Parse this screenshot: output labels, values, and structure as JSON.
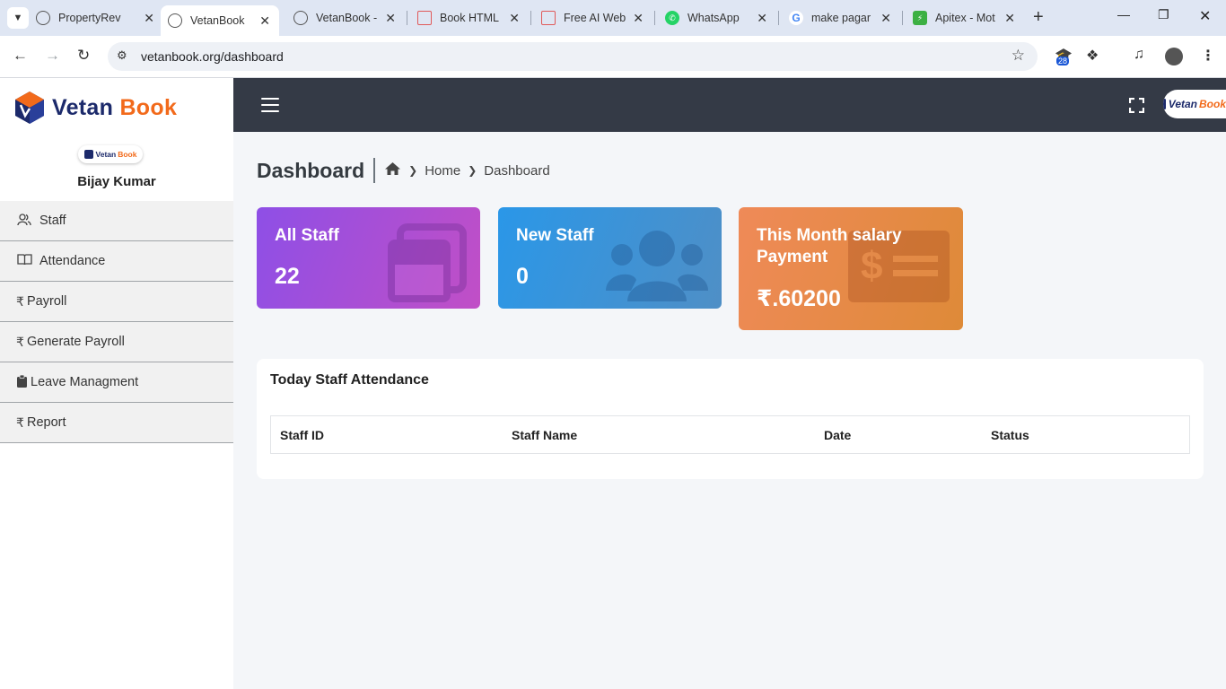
{
  "browser": {
    "tabs": [
      {
        "title": "PropertyReview",
        "icon": "globe-icon"
      },
      {
        "title": "VetanBook",
        "icon": "globe-icon",
        "active": true
      },
      {
        "title": "VetanBook - ",
        "icon": "globe-icon"
      },
      {
        "title": "Book HTML",
        "icon": "document-icon"
      },
      {
        "title": "Free AI Web",
        "icon": "document-icon"
      },
      {
        "title": "WhatsApp",
        "icon": "whatsapp-icon"
      },
      {
        "title": "make pagar",
        "icon": "google-icon"
      },
      {
        "title": "Apitex - Mot",
        "icon": "bolt-icon"
      }
    ],
    "url": "vetanbook.org/dashboard",
    "extensions_badge": "28"
  },
  "brand": {
    "name_part1": "Vetan",
    "name_part2": "Book",
    "mini_part1": "Vetan",
    "mini_part2": "Book",
    "colors": {
      "primary": "#1c2a6b",
      "accent": "#f26a1b"
    }
  },
  "user": {
    "name": "Bijay Kumar"
  },
  "sidebar": {
    "items": [
      {
        "label": "Staff",
        "icon": "users-icon"
      },
      {
        "label": "Attendance",
        "icon": "book-icon"
      },
      {
        "label": "Payroll",
        "icon": "rupee-icon"
      },
      {
        "label": "Generate Payroll",
        "icon": "rupee-icon"
      },
      {
        "label": "Leave Managment",
        "icon": "clipboard-icon"
      },
      {
        "label": "Report",
        "icon": "rupee-icon"
      }
    ]
  },
  "page": {
    "title": "Dashboard",
    "breadcrumb": [
      "Home",
      "Dashboard"
    ]
  },
  "cards": [
    {
      "title": "All Staff",
      "value": "22",
      "icon": "window-icon",
      "color": "#8e4fe6"
    },
    {
      "title": "New Staff",
      "value": "0",
      "icon": "users-icon",
      "color": "#2a97e8"
    },
    {
      "title": "This Month salary Payment",
      "value": "₹.60200",
      "icon": "money-icon",
      "color": "#ef8a58"
    }
  ],
  "attendance": {
    "title_part1": "Today Staff",
    "title_part2": "Attendance",
    "columns": [
      "Staff ID",
      "Staff Name",
      "Date",
      "Status"
    ]
  }
}
